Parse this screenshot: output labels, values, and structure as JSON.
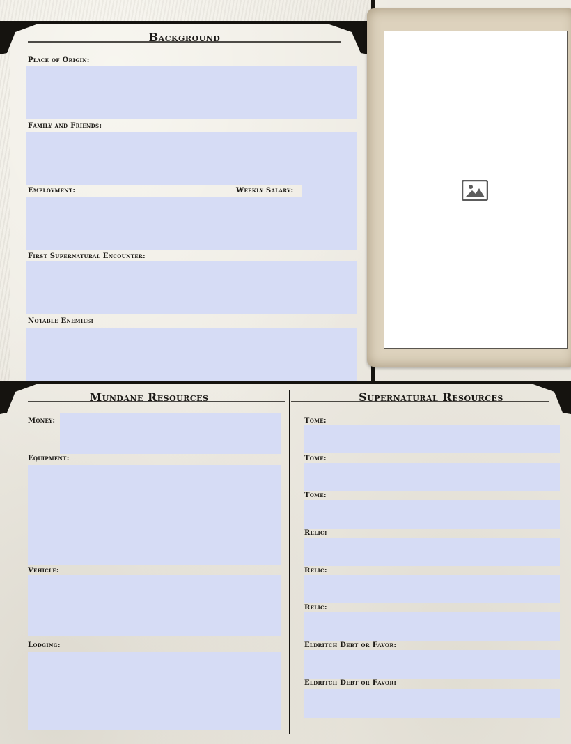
{
  "background": {
    "title": "Background",
    "place_of_origin_label": "Place of Origin:",
    "family_label": "Family and Friends:",
    "employment_label": "Employment:",
    "weekly_salary_label": "Weekly Salary:",
    "first_encounter_label": "First Supernatural Encounter:",
    "enemies_label": "Notable Enemies:"
  },
  "mundane": {
    "title": "Mundane Resources",
    "money_label": "Money:",
    "equipment_label": "Equipment:",
    "vehicle_label": "Vehicle:",
    "lodging_label": "Lodging:"
  },
  "supernatural": {
    "title": "Supernatural Resources",
    "items": [
      {
        "label": "Tome:"
      },
      {
        "label": "Tome:"
      },
      {
        "label": "Tome:"
      },
      {
        "label": "Relic:"
      },
      {
        "label": "Relic:"
      },
      {
        "label": "Relic:"
      },
      {
        "label": "Eldritch Debt or Favor:"
      },
      {
        "label": "Eldritch Debt or Favor:"
      }
    ]
  },
  "portrait": {
    "icon": "image-placeholder-icon"
  },
  "colors": {
    "field_fill": "#d6dcf5",
    "paper": "#eeebe3",
    "ink": "#15130f"
  }
}
